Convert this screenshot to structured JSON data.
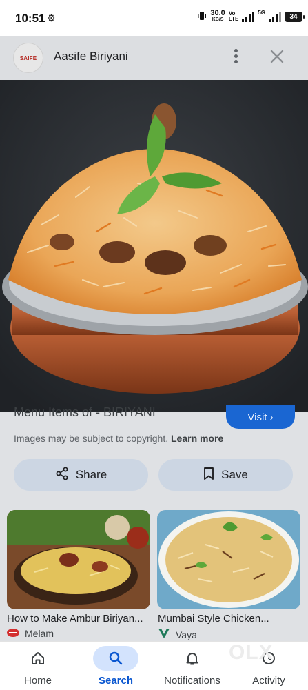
{
  "status_bar": {
    "time": "10:51",
    "net_speed": "30.0",
    "net_unit": "KB/S",
    "volte_top": "Vo",
    "volte_bottom": "LTE",
    "network_type": "5G",
    "battery": "34"
  },
  "viewer": {
    "source_logo_text": "SAIFE",
    "title": "Aasife Biriyani"
  },
  "result": {
    "related_title": "Menu Items of - BIRIYANI",
    "visit_label": "Visit",
    "copyright_text": "Images may be subject to copyright.",
    "learn_more": "Learn more",
    "share_label": "Share",
    "save_label": "Save"
  },
  "related": [
    {
      "caption": "How to Make Ambur Biriyan...",
      "source": "Melam"
    },
    {
      "caption": "Mumbai Style Chicken...",
      "source": "Vaya"
    }
  ],
  "nav": {
    "items": [
      {
        "label": "Home",
        "icon": "home-icon"
      },
      {
        "label": "Search",
        "icon": "search-icon",
        "active": true
      },
      {
        "label": "Notifications",
        "icon": "bell-icon"
      },
      {
        "label": "Activity",
        "icon": "activity-icon"
      }
    ]
  },
  "watermark": "OLX",
  "colors": {
    "accent": "#0b57d0",
    "visit_button": "#1a66d2",
    "action_button_bg": "#ccd6e3",
    "active_nav_pill": "#d3e3fd"
  }
}
